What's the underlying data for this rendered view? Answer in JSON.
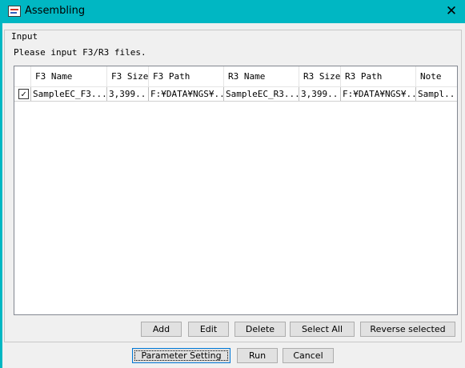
{
  "window": {
    "title": "Assembling",
    "close_symbol": "✕"
  },
  "group": {
    "title": "Input",
    "instruction": "Please input F3/R3 files."
  },
  "table": {
    "columns": [
      "F3 Name",
      "F3 Size",
      "F3 Path",
      "R3 Name",
      "R3 Size",
      "R3 Path",
      "Note"
    ],
    "rows": [
      {
        "checked": true,
        "check_glyph": "✓",
        "cells": [
          "SampleEC_F3....",
          "3,399...",
          "F:¥DATA¥NGS¥...",
          "SampleEC_R3....",
          "3,399...",
          "F:¥DATA¥NGS¥...",
          "Sampl..."
        ]
      }
    ]
  },
  "actions": {
    "add": "Add",
    "edit": "Edit",
    "delete": "Delete",
    "select_all": "Select All",
    "reverse_selected": "Reverse selected"
  },
  "footer": {
    "parameter_setting": "Parameter Setting",
    "run": "Run",
    "cancel": "Cancel"
  },
  "colors": {
    "titlebar": "#00b7c3",
    "dialog_bg": "#f0f0f0",
    "default_button_border": "#0078d7"
  },
  "icons": {
    "app": "assembling-app-icon",
    "close": "close-icon",
    "check": "checkmark-icon"
  }
}
